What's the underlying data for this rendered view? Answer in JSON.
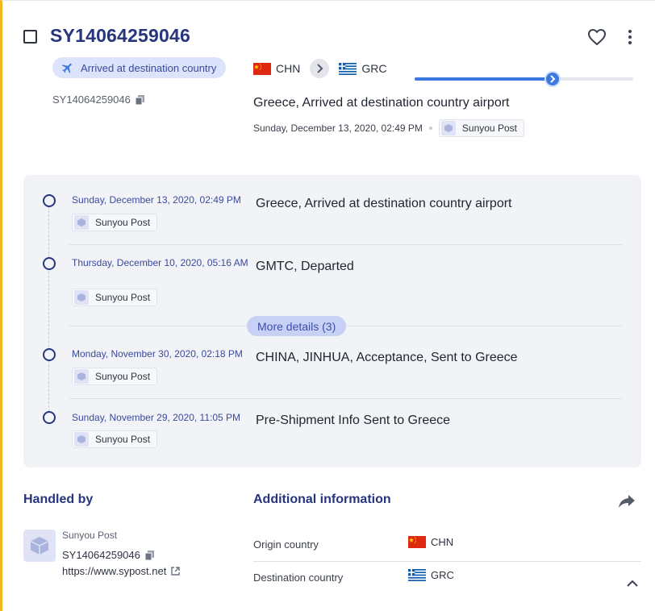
{
  "header": {
    "tracking_number": "SY14064259046",
    "status": "Arrived at destination country",
    "sub_tracking": "SY14064259046"
  },
  "route": {
    "origin_code": "CHN",
    "destination_code": "GRC",
    "progress_percent": 63
  },
  "latest": {
    "event": "Greece, Arrived at destination country airport",
    "datetime": "Sunday, December 13, 2020, 02:49 PM",
    "carrier": "Sunyou Post"
  },
  "timeline": {
    "events": [
      {
        "date": "Sunday, December 13, 2020, 02:49 PM",
        "description": "Greece, Arrived at destination country airport",
        "carrier": "Sunyou Post"
      },
      {
        "date": "Thursday, December 10, 2020, 05:16 AM",
        "description": "GMTC, Departed",
        "carrier": "Sunyou Post"
      },
      {
        "date": "Monday, November 30, 2020, 02:18 PM",
        "description": "CHINA, JINHUA, Acceptance, Sent to Greece",
        "carrier": "Sunyou Post"
      },
      {
        "date": "Sunday, November 29, 2020, 11:05 PM",
        "description": "Pre-Shipment Info Sent to Greece",
        "carrier": "Sunyou Post"
      }
    ],
    "more_label": "More details (3)"
  },
  "handled_by": {
    "title": "Handled by",
    "carrier_name": "Sunyou Post",
    "tracking_number": "SY14064259046",
    "url": "https://www.sypost.net"
  },
  "additional": {
    "title": "Additional information",
    "rows": [
      {
        "label": "Origin country",
        "value": "CHN"
      },
      {
        "label": "Destination country",
        "value": "GRC"
      }
    ]
  },
  "colors": {
    "accent": "#26357d",
    "progress": "#3b78e0",
    "left_border": "#f3b61f"
  }
}
